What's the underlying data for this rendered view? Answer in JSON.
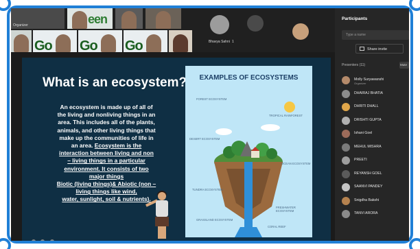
{
  "video_strip": {
    "tiles": [
      {
        "bg_text": "een"
      },
      {
        "bg_text": "Go"
      },
      {
        "bg_text": "Go"
      },
      {
        "bg_text": "Go"
      }
    ],
    "self_label": "Bhavya Sahni",
    "self_count": "1"
  },
  "slide": {
    "title": "What is an ecosystem?",
    "body_lines": [
      "An ecosystem is made up of all of",
      "the living and nonliving things in an",
      "area. This includes all of the plants,",
      "animals, and other living things that",
      "make up the communities of life in",
      "an area."
    ],
    "body_underlined": [
      "Ecosystem is the",
      "interaction between living and non",
      "– living things in a particular",
      "environment. It consists of two",
      "major things",
      "Biotic (living things)& Abiotic (non –",
      "living things like wind,",
      "water, sunlight, soil & nutrients)."
    ],
    "panel_title": "EXAMPLES OF ECOSYSTEMS",
    "panel_labels": [
      "FOREST ECOSYSTEM",
      "TROPICAL RAINFOREST",
      "DESERT ECOSYSTEM",
      "OCEAN ECOSYSTEM",
      "TUNDRA ECOSYSTEM",
      "FRESHWATER ECOSYSTEM",
      "GRASSLAND ECOSYSTEM",
      "CORAL REEF"
    ]
  },
  "participants": {
    "title": "Participants",
    "search_placeholder": "Type a name",
    "share_invite": "Share invite",
    "section": "Presenters (11)",
    "mute_all": "Mute",
    "list": [
      {
        "name": "Molly Suryawanshi",
        "sub": "Organizer",
        "color": "#b48a6a"
      },
      {
        "name": "DHAIRAJ BHATIA",
        "sub": "",
        "color": "#8c8c8c"
      },
      {
        "name": "DHRITI DHALL",
        "sub": "",
        "color": "#e0a64a"
      },
      {
        "name": "DRISHTI GUPTA",
        "sub": "",
        "color": "#b0b0b0"
      },
      {
        "name": "Ishani Goel",
        "sub": "",
        "color": "#9c6b5a"
      },
      {
        "name": "MEHUL MISHRA",
        "sub": "",
        "color": "#7a7a7a"
      },
      {
        "name": "PREETI",
        "sub": "",
        "color": "#9e9e9e"
      },
      {
        "name": "REYANSH GOEL",
        "sub": "",
        "color": "#5a5a5a"
      },
      {
        "name": "SAANVI PANDEY",
        "sub": "",
        "color": "#c5c5c5"
      },
      {
        "name": "Snigdha Bakshi",
        "sub": "",
        "color": "#b5824f"
      },
      {
        "name": "TANVI ARORA",
        "sub": "",
        "color": "#8a8a8a"
      }
    ]
  }
}
